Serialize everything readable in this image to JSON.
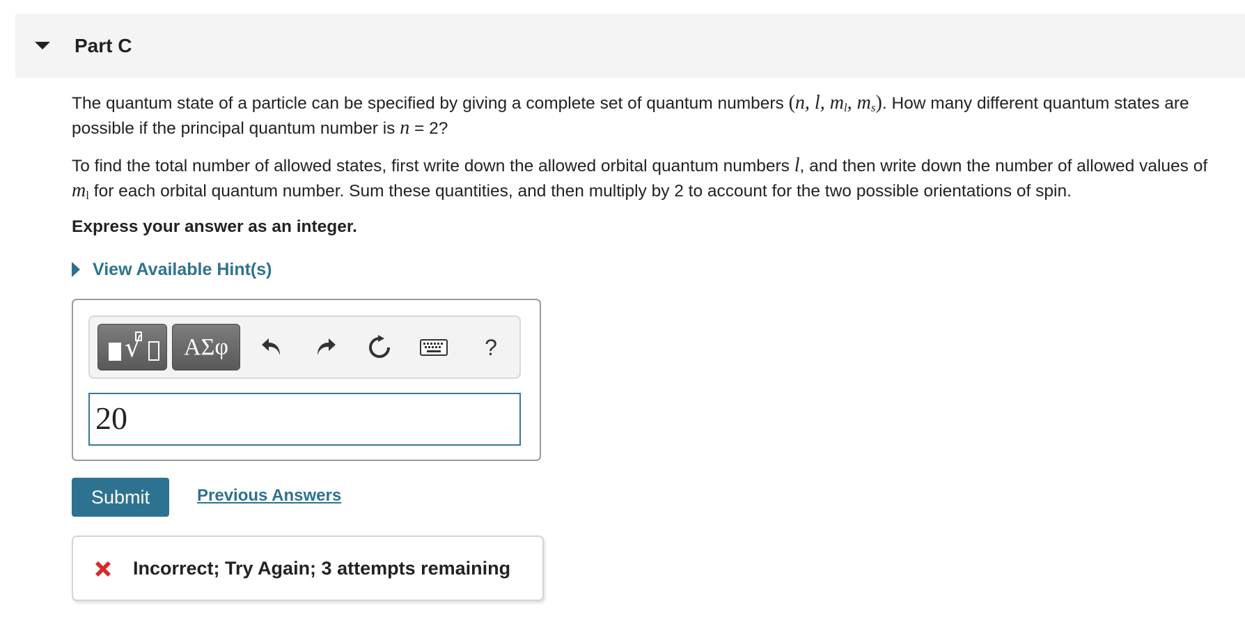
{
  "part": {
    "title": "Part C"
  },
  "question": {
    "p1_a": "The quantum state of a particle can be specified by giving a complete set of quantum numbers ",
    "p1_math": "(n, l, m",
    "p1_sub_l": "l",
    "p1_math2": ", m",
    "p1_sub_s": "s",
    "p1_math3": ")",
    "p1_b": ". How many different quantum states are possible if the principal quantum number is ",
    "p1_n": "n",
    "p1_c": " = 2?",
    "p2_a": "To find the total number of allowed states, first write down the allowed orbital quantum numbers ",
    "p2_l": "l",
    "p2_b": ", and then write down the number of allowed values of ",
    "p2_m": "m",
    "p2_sub": "l",
    "p2_c": " for each orbital quantum number. Sum these quantities, and then multiply by 2 to account for the two possible orientations of spin.",
    "instruction": "Express your answer as an integer."
  },
  "hints": {
    "label": "View Available Hint(s)"
  },
  "toolbar": {
    "greek_label": "ΑΣφ",
    "sqrt_glyph": "√",
    "help_label": "?"
  },
  "answer": {
    "value": "20"
  },
  "actions": {
    "submit_label": "Submit",
    "previous_answers_label": "Previous Answers"
  },
  "feedback": {
    "text": "Incorrect; Try Again; 3 attempts remaining"
  },
  "colors": {
    "link": "#2e7291",
    "submit_bg": "#2e7291",
    "error": "#d62b2b"
  }
}
